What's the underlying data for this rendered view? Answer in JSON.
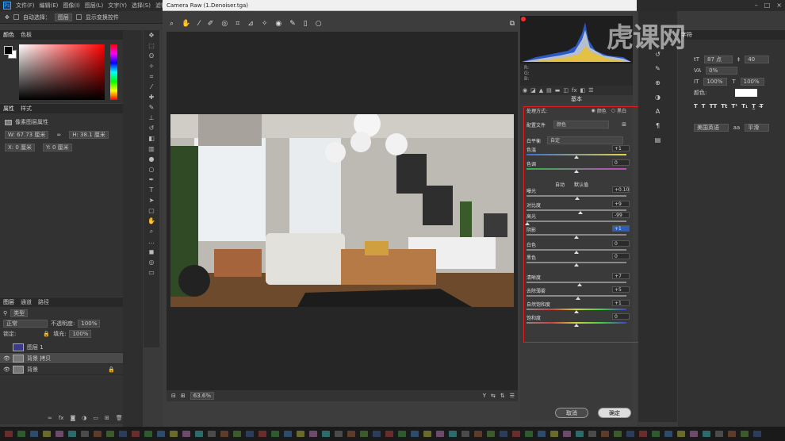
{
  "ps": {
    "menu": [
      "文件(F)",
      "编辑(E)",
      "图像(I)",
      "图层(L)",
      "文字(Y)",
      "选择(S)",
      "滤镜"
    ],
    "options": {
      "auto_select": "自动选择：",
      "group": "图层",
      "show_transform": "显示变换控件"
    },
    "color_tabs": [
      "颜色",
      "色板"
    ],
    "props_tabs": [
      "属性",
      "样式"
    ],
    "props_title": "像素图层属性",
    "props_w": "W: 67.73 厘米",
    "props_h": "H: 38.1 厘米",
    "props_x": "X: 0 厘米",
    "props_y": "Y: 0 厘米",
    "layers_tabs": [
      "图层",
      "通道",
      "路径"
    ],
    "layers_kind": "类型",
    "layers_blend": "正常",
    "layers_opacity_label": "不透明度:",
    "layers_opacity": "100%",
    "layers_lock": "锁定:",
    "layers_fill_label": "填充:",
    "layers_fill": "100%",
    "layers": [
      {
        "name": "图层 1"
      },
      {
        "name": "背景 拷贝"
      },
      {
        "name": "背景"
      }
    ],
    "char_tab": "字符",
    "char_size": "87 点",
    "char_leading": "40",
    "char_tracking": "0%",
    "char_scale_v": "100%",
    "char_scale_h": "100%",
    "char_color_label": "颜色:",
    "char_lang": "美国英语",
    "char_aa": "平滑"
  },
  "cr": {
    "title": "Camera Raw (1.Denoiser.tga)",
    "zoom": "63.6%",
    "section_title": "基本",
    "treatment_label": "处理方式:",
    "treatment_color": "颜色",
    "treatment_bw": "黑白",
    "profile_label": "配置文件",
    "profile_value": "颜色",
    "wb_label": "白平衡",
    "wb_value": "自定",
    "auto": "自动",
    "default": "默认值",
    "sliders": [
      {
        "label": "色温",
        "value": "+1",
        "pos": 0.5
      },
      {
        "label": "色调",
        "value": "0",
        "pos": 0.5
      },
      {
        "label": "曝光",
        "value": "+0.10",
        "pos": 0.51
      },
      {
        "label": "对比度",
        "value": "+9",
        "pos": 0.54
      },
      {
        "label": "高光",
        "value": "-99",
        "pos": 0.0
      },
      {
        "label": "阴影",
        "value": "+1",
        "pos": 0.5
      },
      {
        "label": "白色",
        "value": "0",
        "pos": 0.5
      },
      {
        "label": "黑色",
        "value": "0",
        "pos": 0.5
      },
      {
        "label": "清晰度",
        "value": "+7",
        "pos": 0.53
      },
      {
        "label": "去除薄雾",
        "value": "+5",
        "pos": 0.52
      },
      {
        "label": "自然饱和度",
        "value": "+1",
        "pos": 0.5
      },
      {
        "label": "饱和度",
        "value": "0",
        "pos": 0.5
      }
    ],
    "hist_r": "R:",
    "hist_g": "G:",
    "hist_b": "B:",
    "cancel": "取消",
    "ok": "确定"
  },
  "watermark": "虎课网",
  "colors": {
    "highlight": "#e02020",
    "ps_blue": "#31a8ff"
  }
}
